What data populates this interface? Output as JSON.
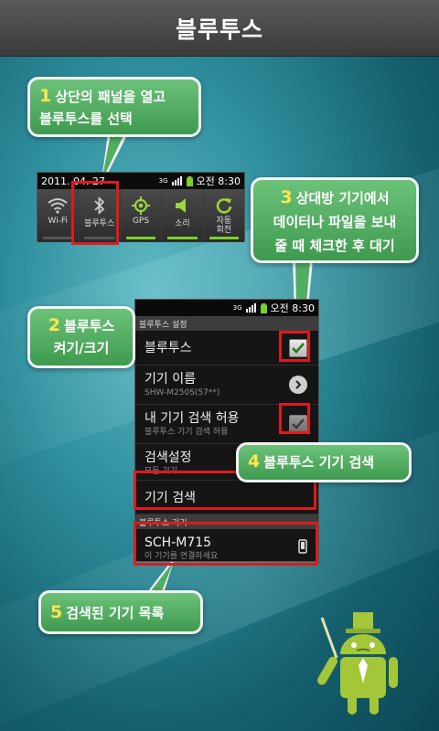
{
  "header": {
    "title": "블루투스"
  },
  "quick_panel": {
    "date": "2011. 04. 27",
    "network": "3G",
    "time": "오전 8:30",
    "toggles": [
      {
        "label": "Wi-Fi",
        "icon": "wifi-icon",
        "on": false
      },
      {
        "label": "블루투스",
        "icon": "bluetooth-icon",
        "on": false
      },
      {
        "label": "GPS",
        "icon": "gps-icon",
        "on": true
      },
      {
        "label": "소리",
        "icon": "sound-icon",
        "on": true
      },
      {
        "label_line1": "자동",
        "label_line2": "회전",
        "icon": "rotate-icon",
        "on": true
      }
    ]
  },
  "settings_screen": {
    "network": "3G",
    "time": "오전 8:30",
    "section1": "블루투스 설정",
    "rows": [
      {
        "title": "블루투스",
        "sub": "",
        "control": "checkbox-checked"
      },
      {
        "title": "기기 이름",
        "sub": "SHW-M250S(57**)",
        "control": "chevron-right"
      },
      {
        "title": "내 기기 검색 허용",
        "sub": "블루투스 기기 검색 허용",
        "control": "checkbox-checked-dim"
      },
      {
        "title": "검색설정",
        "sub": "모든 기기",
        "control": ""
      },
      {
        "title": "기기 검색",
        "sub": "",
        "control": ""
      }
    ],
    "section2": "블루투스 기기",
    "device": {
      "name": "SCH-M715",
      "sub": "이 기기를 연결하세요"
    }
  },
  "callouts": [
    {
      "num": "1",
      "line1": "상단의 패널을 열고",
      "line2": "블루투스를 선택"
    },
    {
      "num": "2",
      "line1": "블루투스",
      "line2": "켜기/크기"
    },
    {
      "num": "3",
      "line1": "상대방 기기에서",
      "line2": "데이터나 파일을 보내",
      "line3": "줄 때 체크한 후 대기"
    },
    {
      "num": "4",
      "line1": "블루투스 기기 검색"
    },
    {
      "num": "5",
      "line1": "검색된 기기 목록"
    }
  ],
  "colors": {
    "callout": "#4fae5f",
    "highlight": "#e01a1a",
    "number": "#ffe74a",
    "android": "#a4c639"
  }
}
